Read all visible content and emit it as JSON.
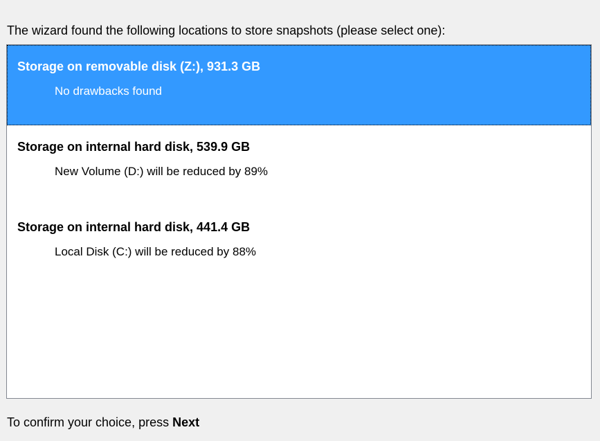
{
  "prompt": "The wizard found the following locations to store snapshots (please select one):",
  "locations": [
    {
      "title": "Storage on removable disk (Z:), 931.3 GB",
      "detail": "No drawbacks found",
      "selected": true
    },
    {
      "title": "Storage on internal hard disk, 539.9 GB",
      "detail": "New Volume (D:) will be reduced by 89%",
      "selected": false
    },
    {
      "title": "Storage on internal hard disk, 441.4 GB",
      "detail": "Local Disk (C:) will be reduced by 88%",
      "selected": false
    }
  ],
  "footer": {
    "text": "To confirm your choice, press ",
    "emphasis": "Next"
  },
  "colors": {
    "selection": "#3399ff",
    "background": "#f0f0f0",
    "list_border": "#828790"
  }
}
